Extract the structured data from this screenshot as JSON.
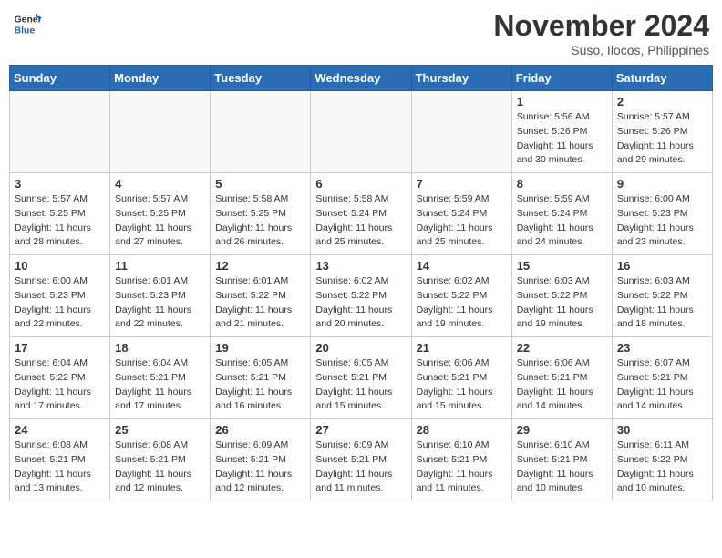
{
  "logo": {
    "line1": "General",
    "line2": "Blue"
  },
  "title": "November 2024",
  "location": "Suso, Ilocos, Philippines",
  "days_of_week": [
    "Sunday",
    "Monday",
    "Tuesday",
    "Wednesday",
    "Thursday",
    "Friday",
    "Saturday"
  ],
  "weeks": [
    [
      {
        "day": "",
        "info": ""
      },
      {
        "day": "",
        "info": ""
      },
      {
        "day": "",
        "info": ""
      },
      {
        "day": "",
        "info": ""
      },
      {
        "day": "",
        "info": ""
      },
      {
        "day": "1",
        "info": "Sunrise: 5:56 AM\nSunset: 5:26 PM\nDaylight: 11 hours\nand 30 minutes."
      },
      {
        "day": "2",
        "info": "Sunrise: 5:57 AM\nSunset: 5:26 PM\nDaylight: 11 hours\nand 29 minutes."
      }
    ],
    [
      {
        "day": "3",
        "info": "Sunrise: 5:57 AM\nSunset: 5:25 PM\nDaylight: 11 hours\nand 28 minutes."
      },
      {
        "day": "4",
        "info": "Sunrise: 5:57 AM\nSunset: 5:25 PM\nDaylight: 11 hours\nand 27 minutes."
      },
      {
        "day": "5",
        "info": "Sunrise: 5:58 AM\nSunset: 5:25 PM\nDaylight: 11 hours\nand 26 minutes."
      },
      {
        "day": "6",
        "info": "Sunrise: 5:58 AM\nSunset: 5:24 PM\nDaylight: 11 hours\nand 25 minutes."
      },
      {
        "day": "7",
        "info": "Sunrise: 5:59 AM\nSunset: 5:24 PM\nDaylight: 11 hours\nand 25 minutes."
      },
      {
        "day": "8",
        "info": "Sunrise: 5:59 AM\nSunset: 5:24 PM\nDaylight: 11 hours\nand 24 minutes."
      },
      {
        "day": "9",
        "info": "Sunrise: 6:00 AM\nSunset: 5:23 PM\nDaylight: 11 hours\nand 23 minutes."
      }
    ],
    [
      {
        "day": "10",
        "info": "Sunrise: 6:00 AM\nSunset: 5:23 PM\nDaylight: 11 hours\nand 22 minutes."
      },
      {
        "day": "11",
        "info": "Sunrise: 6:01 AM\nSunset: 5:23 PM\nDaylight: 11 hours\nand 22 minutes."
      },
      {
        "day": "12",
        "info": "Sunrise: 6:01 AM\nSunset: 5:22 PM\nDaylight: 11 hours\nand 21 minutes."
      },
      {
        "day": "13",
        "info": "Sunrise: 6:02 AM\nSunset: 5:22 PM\nDaylight: 11 hours\nand 20 minutes."
      },
      {
        "day": "14",
        "info": "Sunrise: 6:02 AM\nSunset: 5:22 PM\nDaylight: 11 hours\nand 19 minutes."
      },
      {
        "day": "15",
        "info": "Sunrise: 6:03 AM\nSunset: 5:22 PM\nDaylight: 11 hours\nand 19 minutes."
      },
      {
        "day": "16",
        "info": "Sunrise: 6:03 AM\nSunset: 5:22 PM\nDaylight: 11 hours\nand 18 minutes."
      }
    ],
    [
      {
        "day": "17",
        "info": "Sunrise: 6:04 AM\nSunset: 5:22 PM\nDaylight: 11 hours\nand 17 minutes."
      },
      {
        "day": "18",
        "info": "Sunrise: 6:04 AM\nSunset: 5:21 PM\nDaylight: 11 hours\nand 17 minutes."
      },
      {
        "day": "19",
        "info": "Sunrise: 6:05 AM\nSunset: 5:21 PM\nDaylight: 11 hours\nand 16 minutes."
      },
      {
        "day": "20",
        "info": "Sunrise: 6:05 AM\nSunset: 5:21 PM\nDaylight: 11 hours\nand 15 minutes."
      },
      {
        "day": "21",
        "info": "Sunrise: 6:06 AM\nSunset: 5:21 PM\nDaylight: 11 hours\nand 15 minutes."
      },
      {
        "day": "22",
        "info": "Sunrise: 6:06 AM\nSunset: 5:21 PM\nDaylight: 11 hours\nand 14 minutes."
      },
      {
        "day": "23",
        "info": "Sunrise: 6:07 AM\nSunset: 5:21 PM\nDaylight: 11 hours\nand 14 minutes."
      }
    ],
    [
      {
        "day": "24",
        "info": "Sunrise: 6:08 AM\nSunset: 5:21 PM\nDaylight: 11 hours\nand 13 minutes."
      },
      {
        "day": "25",
        "info": "Sunrise: 6:08 AM\nSunset: 5:21 PM\nDaylight: 11 hours\nand 12 minutes."
      },
      {
        "day": "26",
        "info": "Sunrise: 6:09 AM\nSunset: 5:21 PM\nDaylight: 11 hours\nand 12 minutes."
      },
      {
        "day": "27",
        "info": "Sunrise: 6:09 AM\nSunset: 5:21 PM\nDaylight: 11 hours\nand 11 minutes."
      },
      {
        "day": "28",
        "info": "Sunrise: 6:10 AM\nSunset: 5:21 PM\nDaylight: 11 hours\nand 11 minutes."
      },
      {
        "day": "29",
        "info": "Sunrise: 6:10 AM\nSunset: 5:21 PM\nDaylight: 11 hours\nand 10 minutes."
      },
      {
        "day": "30",
        "info": "Sunrise: 6:11 AM\nSunset: 5:22 PM\nDaylight: 11 hours\nand 10 minutes."
      }
    ]
  ]
}
